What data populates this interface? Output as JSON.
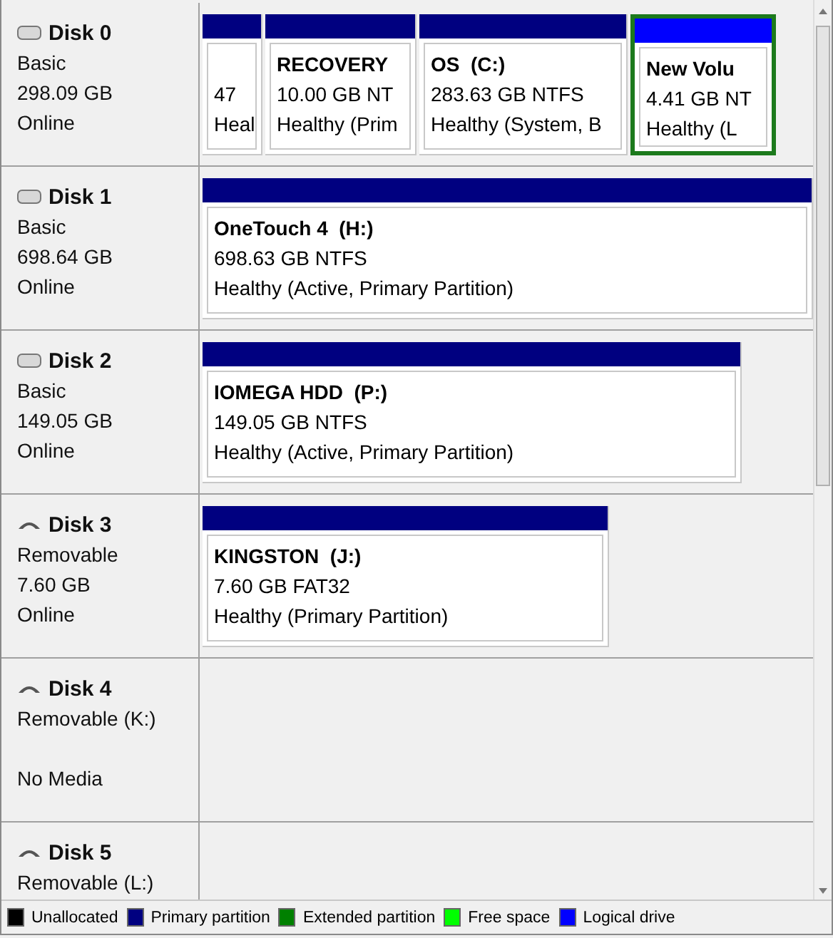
{
  "disks": [
    {
      "name": "Disk 0",
      "kind": "basic",
      "type": "Basic",
      "size": "298.09 GB",
      "status": "Online",
      "partitions": [
        {
          "size": "47",
          "health": "Heal",
          "color": "#000080",
          "selected": false
        },
        {
          "name": "RECOVERY",
          "size": "10.00 GB NT",
          "health": "Healthy (Prim",
          "color": "#000080",
          "selected": false
        },
        {
          "name": "OS  (C:)",
          "size": "283.63 GB NTFS",
          "health": "Healthy (System, B",
          "color": "#000080",
          "selected": false
        },
        {
          "name": "New Volu",
          "size": "4.41 GB NT",
          "health": "Healthy (L",
          "color": "#0000ff",
          "selected": true
        }
      ]
    },
    {
      "name": "Disk 1",
      "kind": "basic",
      "type": "Basic",
      "size": "698.64 GB",
      "status": "Online",
      "partitions": [
        {
          "name": "OneTouch 4  (H:)",
          "size": "698.63 GB NTFS",
          "health": "Healthy (Active, Primary Partition)",
          "color": "#000080",
          "selected": false
        }
      ]
    },
    {
      "name": "Disk 2",
      "kind": "basic",
      "type": "Basic",
      "size": "149.05 GB",
      "status": "Online",
      "partitions": [
        {
          "name": "IOMEGA HDD  (P:)",
          "size": "149.05 GB NTFS",
          "health": "Healthy (Active, Primary Partition)",
          "color": "#000080",
          "selected": false
        }
      ]
    },
    {
      "name": "Disk 3",
      "kind": "removable",
      "type": "Removable",
      "size": "7.60 GB",
      "status": "Online",
      "partitions": [
        {
          "name": "KINGSTON  (J:)",
          "size": "7.60 GB FAT32",
          "health": "Healthy (Primary Partition)",
          "color": "#000080",
          "selected": false
        }
      ]
    },
    {
      "name": "Disk 4",
      "kind": "removable",
      "type": "Removable (K:)",
      "status": "No Media"
    },
    {
      "name": "Disk 5",
      "kind": "removable",
      "type": "Removable (L:)"
    }
  ],
  "legend": [
    {
      "label": "Unallocated",
      "color": "#000000"
    },
    {
      "label": "Primary partition",
      "color": "#000080"
    },
    {
      "label": "Extended partition",
      "color": "#008000"
    },
    {
      "label": "Free space",
      "color": "#00ff00"
    },
    {
      "label": "Logical drive",
      "color": "#0000ff"
    }
  ]
}
